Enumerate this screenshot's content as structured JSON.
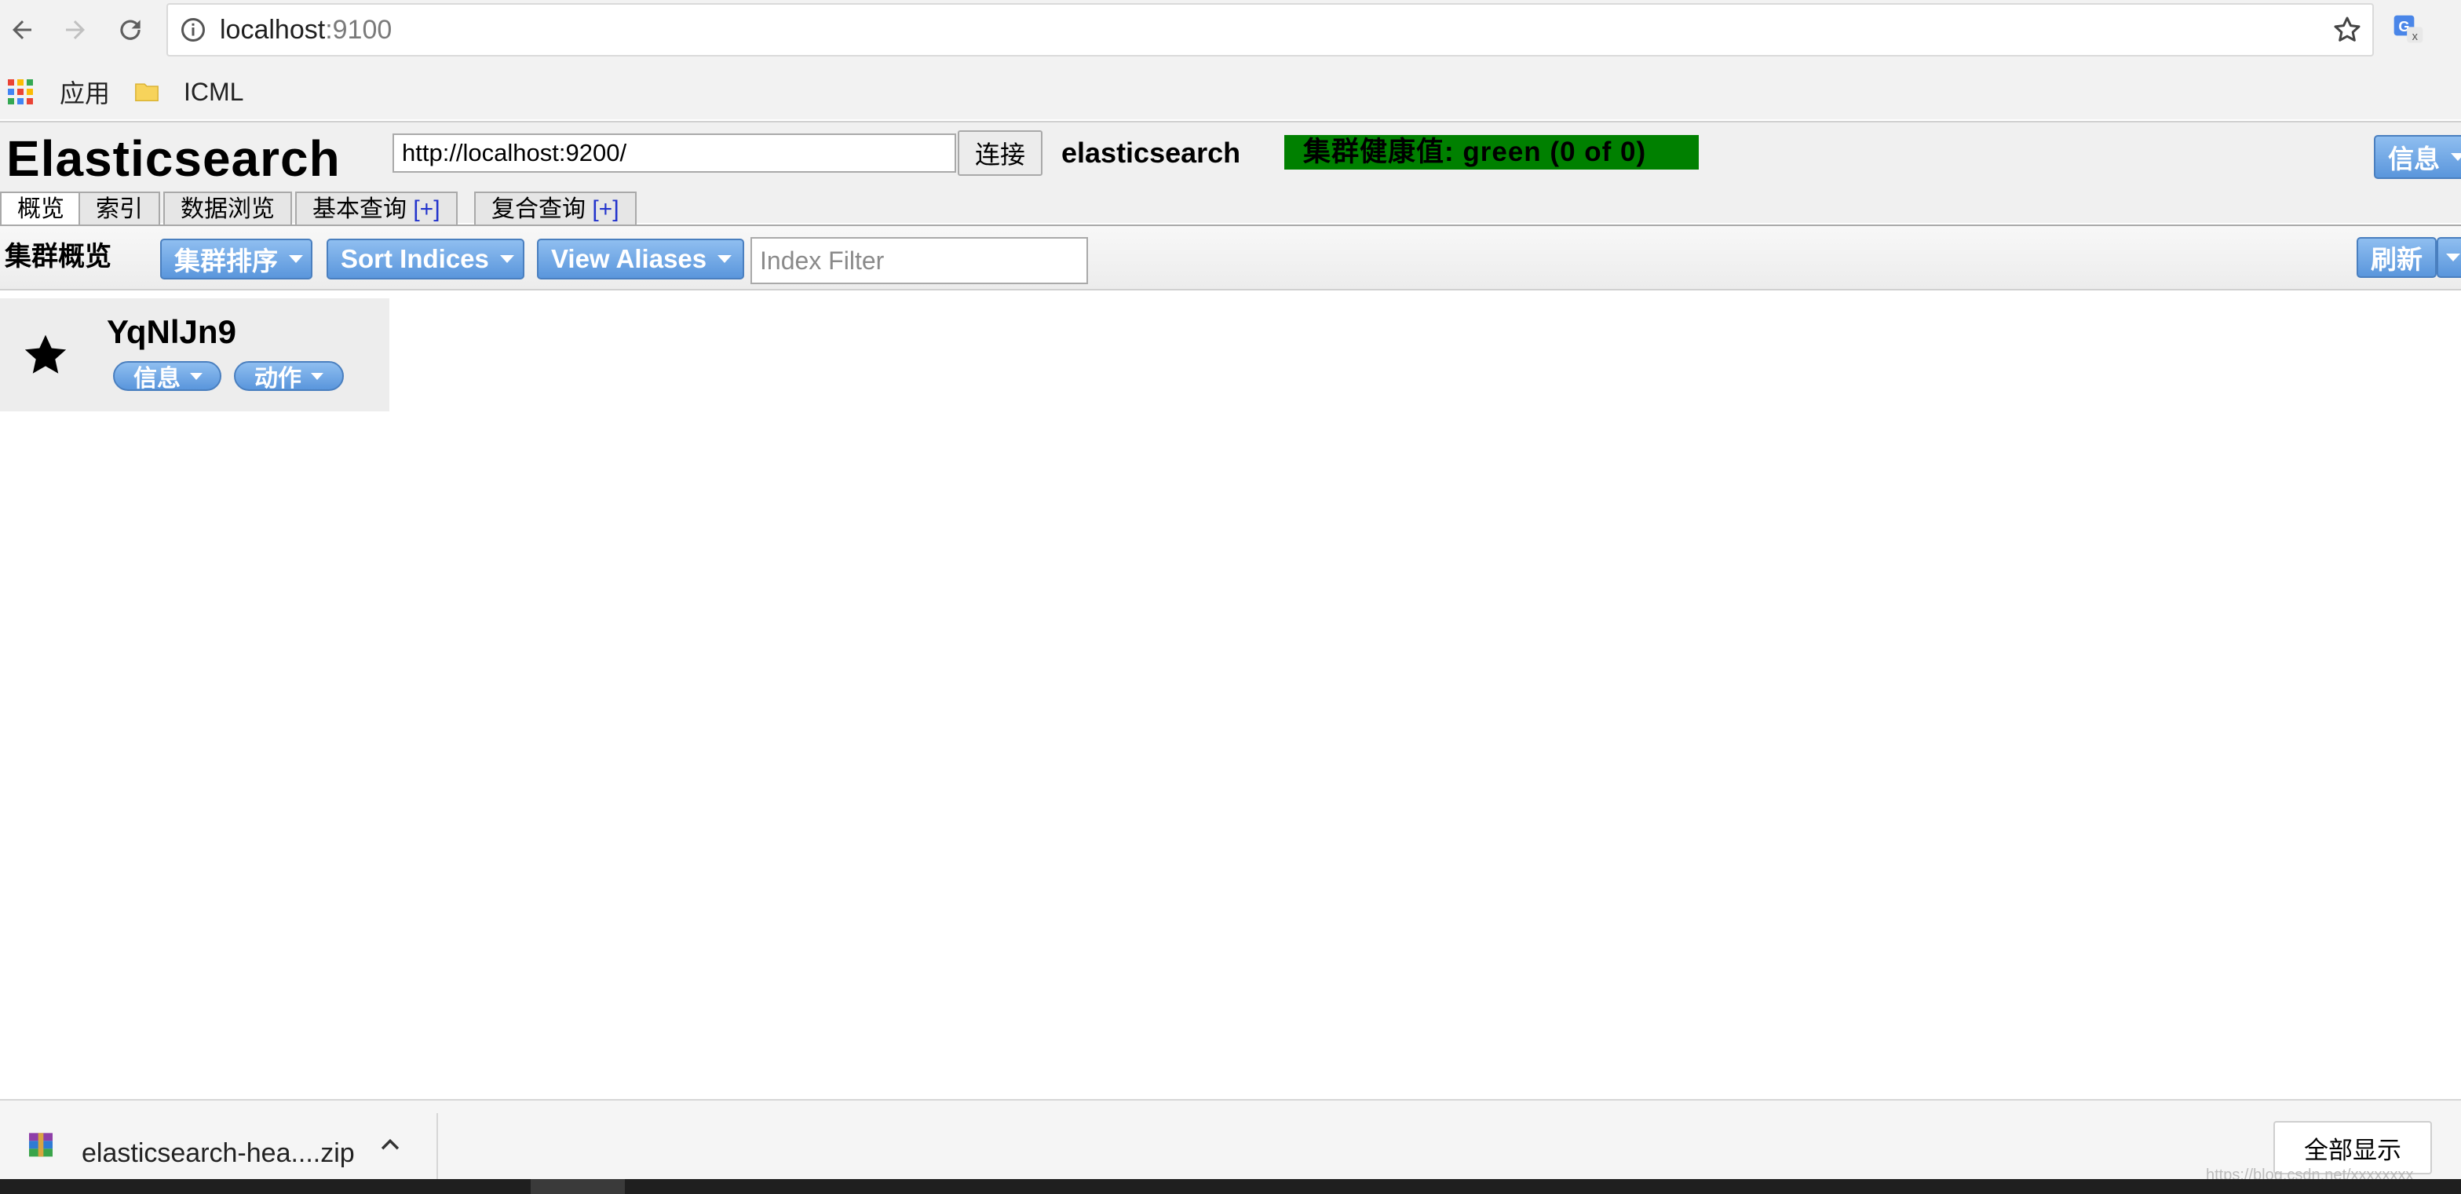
{
  "browser": {
    "url_host": "localhost",
    "url_port": ":9100",
    "bookmarks": [
      {
        "label": "应用"
      },
      {
        "label": "ICML"
      }
    ]
  },
  "app": {
    "title": "Elasticsearch",
    "connect_url": "http://localhost:9200/",
    "connect_label": "连接",
    "cluster_name": "elasticsearch",
    "health_text": "集群健康值: green (0 of 0)",
    "health_color": "#008000",
    "info_label": "信息",
    "tabs": [
      {
        "label": "概览",
        "plus": ""
      },
      {
        "label": "索引",
        "plus": ""
      },
      {
        "label": "数据浏览",
        "plus": ""
      },
      {
        "label": "基本查询 ",
        "plus": "[+]"
      },
      {
        "label": "复合查询 ",
        "plus": "[+]"
      }
    ]
  },
  "toolbar": {
    "title": "集群概览",
    "sort_cluster_label": "集群排序",
    "sort_indices_label": "Sort Indices",
    "view_aliases_label": "View Aliases",
    "index_filter_placeholder": "Index Filter",
    "refresh_label": "刷新"
  },
  "node": {
    "name": "YqNlJn9",
    "info_label": "信息",
    "action_label": "动作"
  },
  "download": {
    "file_name": "elasticsearch-hea....zip",
    "show_all_label": "全部显示"
  },
  "watermark": "https://blog.csdn.net/xxxxxxxx",
  "colors": {
    "accent_blue": "#5a96dc",
    "health_green": "#008000"
  }
}
